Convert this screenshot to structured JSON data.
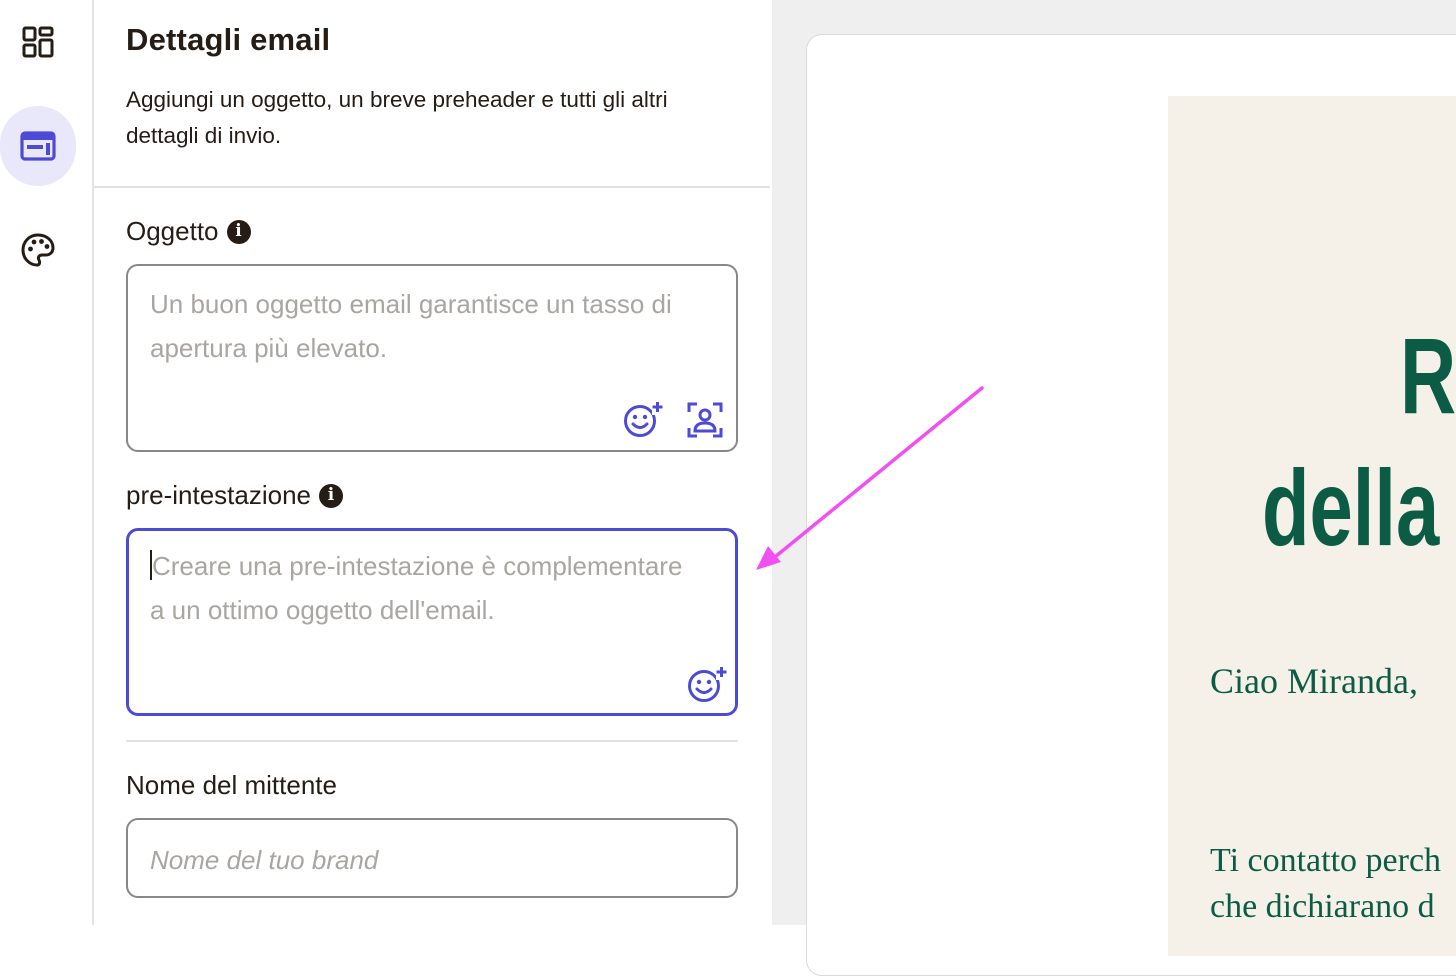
{
  "rail": {
    "items": [
      {
        "icon": "layout-grid-icon",
        "active": false
      },
      {
        "icon": "email-details-icon",
        "active": true
      },
      {
        "icon": "palette-icon",
        "active": false
      }
    ]
  },
  "panel": {
    "title": "Dettagli email",
    "description": "Aggiungi un oggetto, un breve preheader e tutti gli altri dettagli di invio.",
    "subject": {
      "label": "Oggetto",
      "value": "",
      "placeholder": "Un buon oggetto email garantisce un tasso di apertura più elevato.",
      "icons": [
        "emoji-add-icon",
        "personalize-icon"
      ]
    },
    "preheader": {
      "label": "pre-intestazione",
      "value": "",
      "placeholder": "Creare una pre-intestazione è complementare a un ottimo oggetto dell'email.",
      "focused": true,
      "icons": [
        "emoji-add-icon"
      ]
    },
    "sender": {
      "label": "Nome del mittente",
      "value": "",
      "placeholder": "Nome del tuo brand"
    }
  },
  "preview": {
    "hero_line_1": "R",
    "hero_line_2": "della",
    "greeting": "Ciao Miranda,",
    "body_line_1": "Ti contatto perch",
    "body_line_2": "che dichiarano d"
  },
  "annotation": {
    "arrow_color": "#f24ff2",
    "icon": "annotation-arrow-icon"
  },
  "colors": {
    "accent": "#4d4bd6",
    "accent_bg": "#e9e8fb",
    "email_green": "#0c5c45",
    "email_bg": "#f5f1e9",
    "arrow": "#f24ff2"
  }
}
